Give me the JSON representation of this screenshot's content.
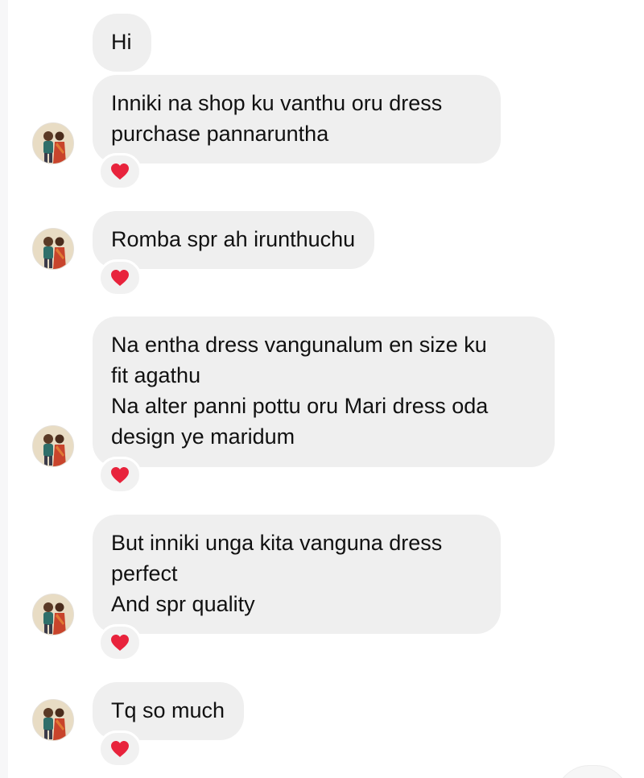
{
  "messages": [
    {
      "lines": [
        "Hi"
      ],
      "has_avatar": false,
      "reaction": null
    },
    {
      "lines": [
        "Inniki na shop ku vanthu oru dress",
        "purchase pannaruntha"
      ],
      "has_avatar": true,
      "reaction": "heart-icon"
    },
    {
      "lines": [
        "Romba spr ah irunthuchu"
      ],
      "has_avatar": true,
      "reaction": "heart-icon"
    },
    {
      "lines": [
        "Na entha dress vangunalum en size ku",
        "fit agathu",
        "Na alter panni pottu oru Mari dress oda",
        "design ye maridum"
      ],
      "has_avatar": true,
      "reaction": "heart-icon"
    },
    {
      "lines": [
        "But inniki unga kita vanguna dress",
        "perfect",
        "And spr quality"
      ],
      "has_avatar": true,
      "reaction": "heart-icon"
    },
    {
      "lines": [
        "Tq so much"
      ],
      "has_avatar": true,
      "reaction": "heart-icon"
    }
  ],
  "colors": {
    "bubble": "#efefef",
    "text": "#111111",
    "heart": "#e8233c",
    "background": "#ffffff"
  }
}
